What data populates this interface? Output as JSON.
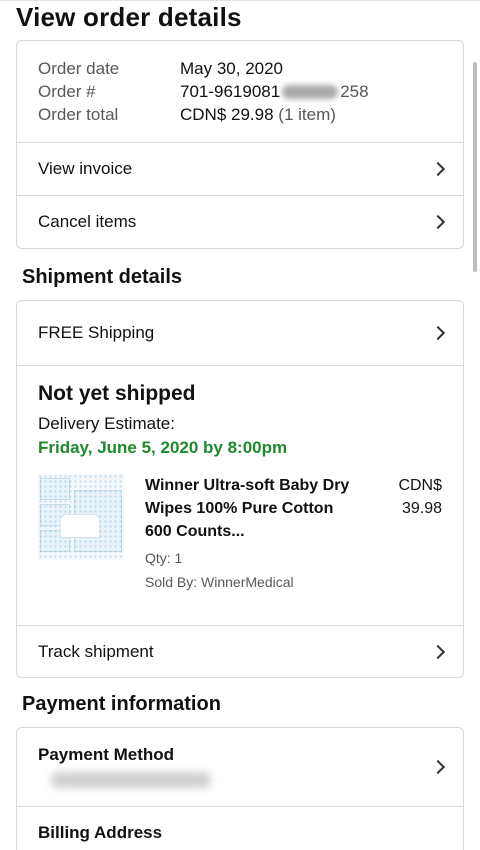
{
  "page_title": "View order details",
  "order_summary": {
    "date_label": "Order date",
    "date_value": "May 30, 2020",
    "number_label": "Order #",
    "number_prefix": "701-9619081",
    "number_suffix": "258",
    "total_label": "Order total",
    "total_value": "CDN$ 29.98",
    "total_items": "(1 item)",
    "view_invoice": "View invoice",
    "cancel_items": "Cancel items"
  },
  "shipment": {
    "section_title": "Shipment details",
    "shipping_label": "FREE Shipping",
    "status": "Not yet shipped",
    "delivery_label": "Delivery Estimate:",
    "delivery_date": "Friday, June 5, 2020 by 8:00pm",
    "product": {
      "title": "Winner Ultra-soft Baby Dry Wipes 100% Pure Cotton 600 Counts...",
      "price_currency": "CDN$",
      "price_value": "39.98",
      "qty": "Qty: 1",
      "seller": "Sold By: WinnerMedical"
    },
    "track_label": "Track shipment"
  },
  "payment": {
    "section_title": "Payment information",
    "method_label": "Payment Method",
    "billing_label": "Billing Address"
  },
  "icons": {
    "chevron": "chevron-right-icon"
  },
  "colors": {
    "delivery_green": "#1e8a2c",
    "border": "#d5d9d9"
  }
}
